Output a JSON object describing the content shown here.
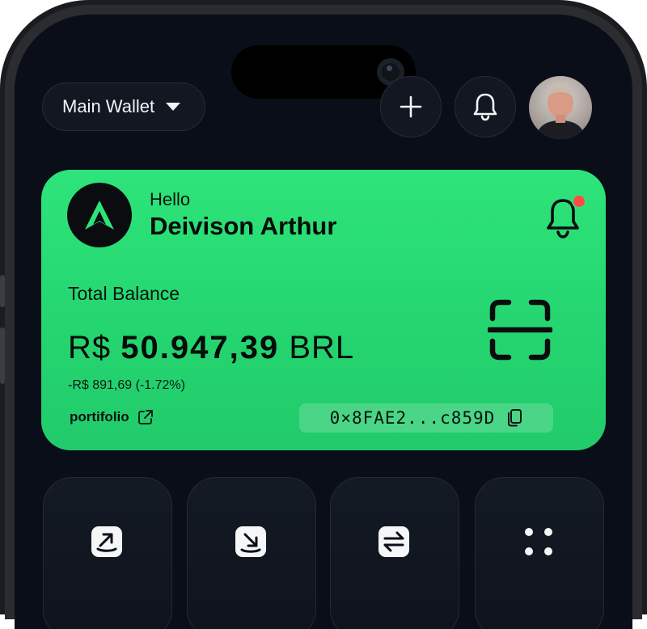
{
  "header": {
    "wallet_selector": "Main Wallet"
  },
  "card": {
    "greeting": "Hello",
    "user_name": "Deivison Arthur",
    "total_label": "Total Balance",
    "currency_prefix": "R$",
    "balance_amount": "50.947,39",
    "currency_suffix": "BRL",
    "change": "-R$ 891,69 (-1.72%)",
    "portfolio_link": "portifolio",
    "wallet_address": "0×8FAE2...c859D"
  },
  "colors": {
    "card_green": "#2ee47a",
    "screen_bg": "#0a0e18",
    "notification_dot": "#ff4a4a"
  },
  "icons": {
    "header": [
      "plus-icon",
      "bell-icon",
      "avatar"
    ],
    "card": [
      "app-logo-icon",
      "bell-icon",
      "scan-qr-icon",
      "external-link-icon",
      "copy-icon"
    ],
    "actions": [
      "send-icon",
      "receive-icon",
      "swap-icon",
      "more-grid-icon"
    ]
  }
}
